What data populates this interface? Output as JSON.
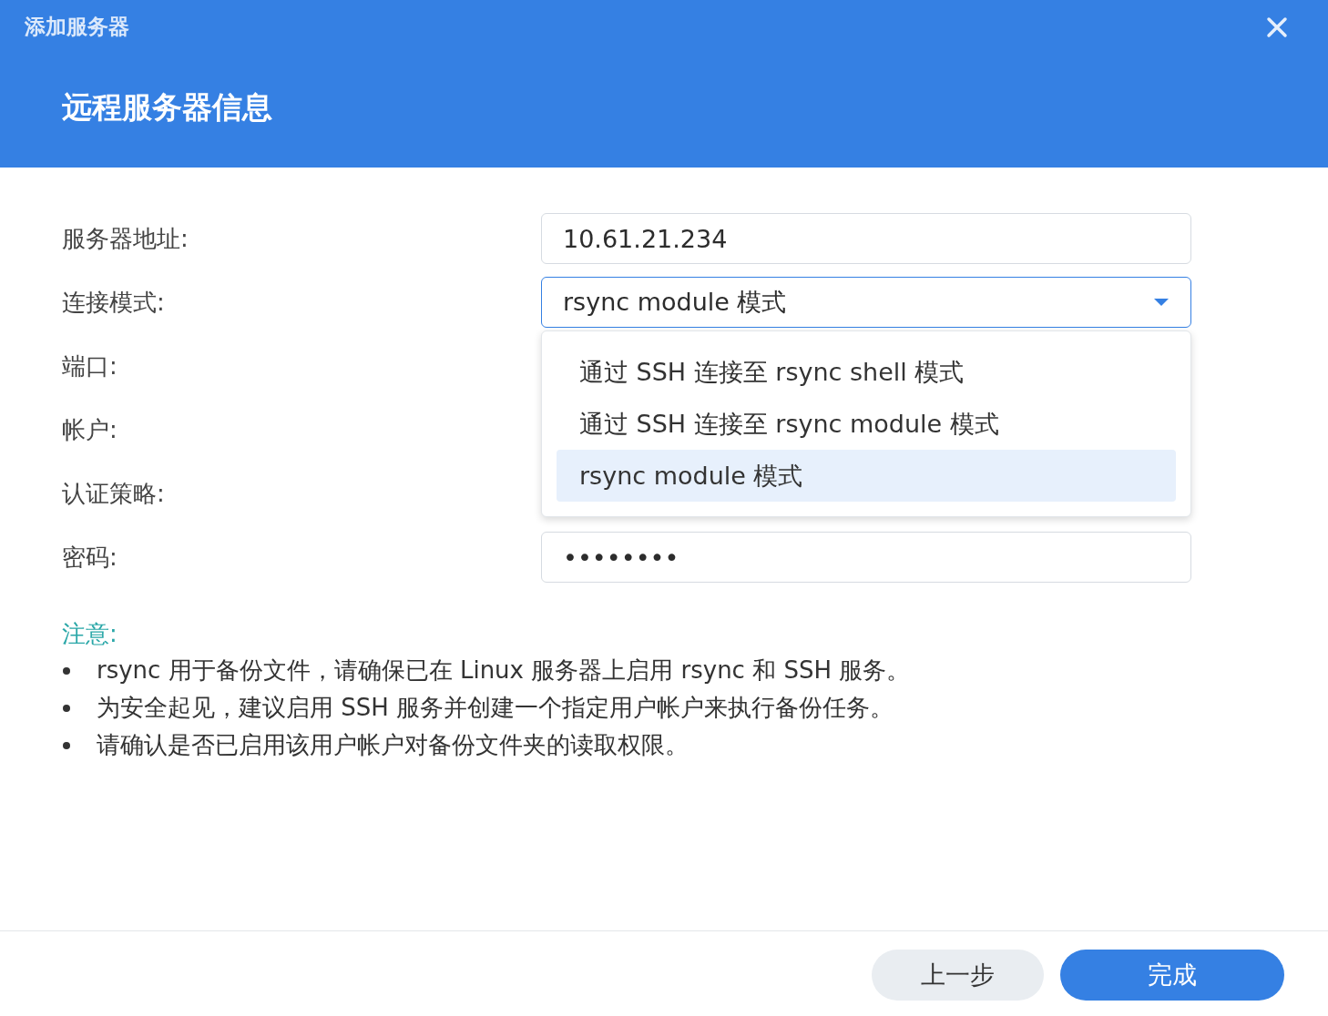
{
  "dialog": {
    "title": "添加服务器"
  },
  "header": {
    "subtitle": "远程服务器信息"
  },
  "fields": [
    {
      "label": "服务器地址:",
      "kind": "text",
      "value": "10.61.21.234"
    },
    {
      "label": "连接模式:",
      "kind": "select",
      "value": "rsync module 模式",
      "expanded": true,
      "options": [
        {
          "label": "通过 SSH 连接至 rsync shell 模式",
          "selected": false
        },
        {
          "label": "通过 SSH 连接至 rsync module 模式",
          "selected": false
        },
        {
          "label": "rsync module 模式",
          "selected": true
        }
      ]
    },
    {
      "label": "端口:",
      "kind": "covered"
    },
    {
      "label": "帐户:",
      "kind": "covered"
    },
    {
      "label": "认证策略:",
      "kind": "covered"
    },
    {
      "label": "密码:",
      "kind": "password",
      "value": "••••••••"
    }
  ],
  "notes": {
    "title": "注意:",
    "items": [
      "rsync 用于备份文件，请确保已在 Linux 服务器上启用 rsync 和 SSH 服务。",
      "为安全起见，建议启用 SSH 服务并创建一个指定用户帐户来执行备份任务。",
      "请确认是否已启用该用户帐户对备份文件夹的读取权限。"
    ]
  },
  "buttons": [
    {
      "label": "上一步",
      "kind": "secondary"
    },
    {
      "label": "完成",
      "kind": "primary"
    }
  ]
}
